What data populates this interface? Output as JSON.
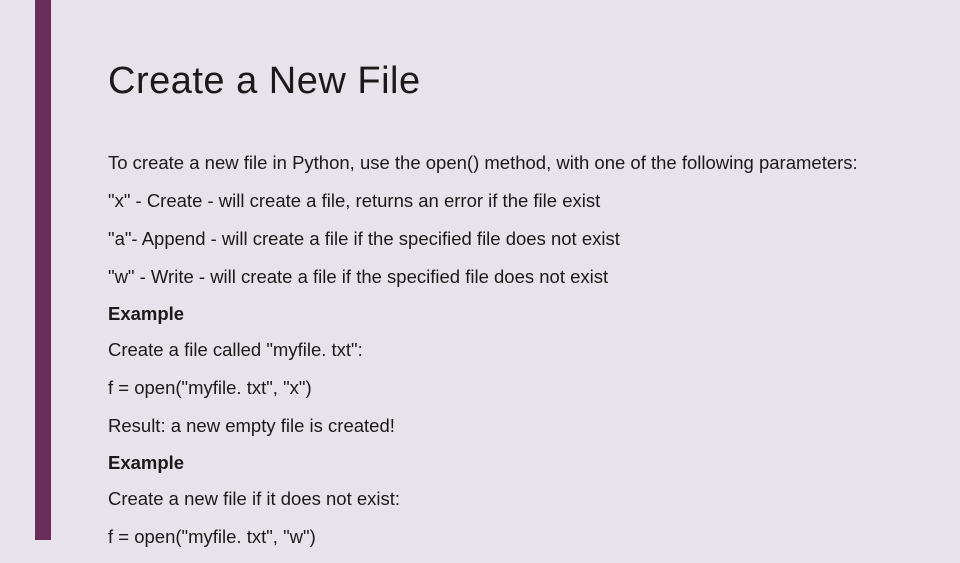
{
  "title": "Create a New File",
  "intro": "To create a new file in Python, use the open() method, with one of the following parameters:",
  "modes": {
    "x": "\"x\" - Create - will create a file, returns an error if the file exist",
    "a": "\"a\"- Append - will create a file if the specified file does not exist",
    "w": "\"w\" - Write - will create a file if the specified file does not exist"
  },
  "example1": {
    "label": "Example",
    "desc": "Create a file called \"myfile. txt\":",
    "code": "f = open(\"myfile. txt\", \"x\")",
    "result": "Result: a new empty file is created!"
  },
  "example2": {
    "label": "Example",
    "desc": "Create a new file if it does not exist:",
    "code": "f = open(\"myfile. txt\", \"w\")"
  }
}
